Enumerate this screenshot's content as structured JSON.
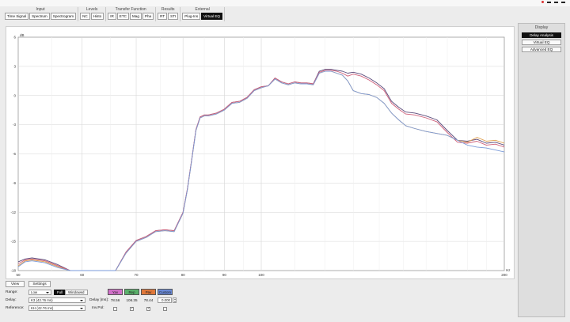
{
  "ribbon": {
    "groups": [
      {
        "title": "Input",
        "buttons": [
          "Time Signal",
          "Spectrum",
          "Spectrogram"
        ],
        "active": -1
      },
      {
        "title": "Levels",
        "buttons": [
          "NC",
          "Histo"
        ],
        "active": -1
      },
      {
        "title": "Transfer Function",
        "buttons": [
          "IR",
          "ETC",
          "Mag",
          "Pha"
        ],
        "active": -1
      },
      {
        "title": "Results",
        "buttons": [
          "RT",
          "STI"
        ],
        "active": -1
      },
      {
        "title": "External",
        "buttons": [
          "Plug-Ins",
          "Virtual EQ"
        ],
        "active": 1
      }
    ]
  },
  "display_panel": {
    "title": "Display",
    "buttons": [
      "Delay Analysis",
      "Virtual EQ",
      "Advanced EQ"
    ],
    "active": 0
  },
  "chart_data": {
    "type": "line",
    "xscale": "log",
    "xlim": [
      50,
      200
    ],
    "ylim": [
      -18,
      6
    ],
    "x_tick_labels": [
      "50",
      "60",
      "70",
      "80",
      "90",
      "100",
      "200"
    ],
    "x_unit": "Hz",
    "y_tick_labels": [
      "6",
      "3",
      "0",
      "-3",
      "-6",
      "-9",
      "-12",
      "-15",
      "-18"
    ],
    "y_unit": "dB",
    "grid": true,
    "x": [
      50,
      51,
      52,
      54,
      56,
      58,
      60,
      62,
      64,
      66,
      68,
      70,
      72,
      74,
      76,
      78,
      80,
      81,
      82,
      83,
      84,
      85,
      86,
      88,
      90,
      92,
      94,
      96,
      98,
      100,
      102,
      104,
      106,
      108,
      110,
      112,
      114,
      116,
      118,
      120,
      122,
      124,
      126,
      128,
      130,
      133,
      136,
      139,
      142,
      145,
      148,
      151,
      155,
      160,
      165,
      170,
      175,
      180,
      185,
      190,
      195,
      200
    ],
    "series": [
      {
        "color": "#5a4a7a",
        "values": [
          -17.1,
          -16.8,
          -16.7,
          -16.9,
          -17.4,
          -18.2,
          -18.8,
          -18.9,
          -18.9,
          -18.3,
          -16.1,
          -14.9,
          -14.5,
          -13.9,
          -13.8,
          -13.9,
          -12.0,
          -9.6,
          -6.6,
          -3.5,
          -2.2,
          -2.0,
          -2.0,
          -1.8,
          -1.4,
          -0.7,
          -0.6,
          -0.2,
          0.6,
          0.9,
          1.0,
          1.8,
          1.4,
          1.2,
          1.4,
          1.3,
          1.3,
          1.2,
          2.5,
          2.7,
          2.7,
          2.6,
          2.5,
          2.3,
          2.4,
          2.2,
          1.8,
          1.3,
          0.7,
          -0.6,
          -1.2,
          -1.7,
          -1.8,
          -2.1,
          -2.5,
          -3.6,
          -4.6,
          -4.7,
          -4.5,
          -4.9,
          -4.8,
          -5.1
        ]
      },
      {
        "color": "#e0a050",
        "values": [
          -17.5,
          -17.0,
          -16.9,
          -17.1,
          -17.6,
          -18.3,
          -18.8,
          -18.9,
          -18.9,
          -18.4,
          -16.2,
          -15.0,
          -14.6,
          -14.0,
          -13.9,
          -14.0,
          -12.1,
          -9.7,
          -6.7,
          -3.6,
          -2.3,
          -2.1,
          -2.1,
          -1.9,
          -1.5,
          -0.8,
          -0.7,
          -0.3,
          0.5,
          0.8,
          1.0,
          1.7,
          1.3,
          1.1,
          1.3,
          1.2,
          1.2,
          1.1,
          2.3,
          2.5,
          2.5,
          2.3,
          2.1,
          1.5,
          0.5,
          0.2,
          0.1,
          -0.2,
          -0.8,
          -1.8,
          -2.5,
          -3.1,
          -3.4,
          -3.7,
          -3.9,
          -4.1,
          -4.6,
          -4.8,
          -4.3,
          -4.7,
          -4.6,
          -4.9
        ]
      },
      {
        "color": "#d0607a",
        "values": [
          -17.3,
          -16.9,
          -16.8,
          -17.0,
          -17.5,
          -18.2,
          -18.8,
          -18.9,
          -18.9,
          -18.4,
          -16.1,
          -14.9,
          -14.5,
          -13.9,
          -13.8,
          -13.9,
          -12.0,
          -9.6,
          -6.6,
          -3.5,
          -2.2,
          -2.0,
          -2.0,
          -1.8,
          -1.4,
          -0.7,
          -0.6,
          -0.2,
          0.6,
          0.9,
          1.0,
          1.8,
          1.4,
          1.2,
          1.4,
          1.3,
          1.3,
          1.2,
          2.4,
          2.6,
          2.6,
          2.5,
          2.3,
          2.0,
          2.2,
          2.0,
          1.6,
          1.1,
          0.5,
          -0.8,
          -1.4,
          -1.9,
          -2.0,
          -2.3,
          -2.7,
          -3.8,
          -4.8,
          -4.9,
          -4.7,
          -5.1,
          -5.0,
          -5.3
        ]
      },
      {
        "color": "#7a9ad8",
        "values": [
          -17.6,
          -17.1,
          -17.0,
          -17.2,
          -17.7,
          -18.3,
          -18.8,
          -18.9,
          -18.9,
          -18.4,
          -16.2,
          -15.0,
          -14.6,
          -14.0,
          -13.9,
          -14.0,
          -12.1,
          -9.7,
          -6.7,
          -3.6,
          -2.3,
          -2.1,
          -2.1,
          -1.9,
          -1.5,
          -0.8,
          -0.7,
          -0.3,
          0.5,
          0.8,
          1.0,
          1.7,
          1.3,
          1.1,
          1.3,
          1.2,
          1.2,
          1.1,
          2.3,
          2.5,
          2.5,
          2.3,
          2.1,
          1.5,
          0.5,
          0.2,
          0.1,
          -0.2,
          -0.8,
          -1.8,
          -2.5,
          -3.1,
          -3.4,
          -3.7,
          -3.9,
          -4.1,
          -4.6,
          -5.1,
          -5.3,
          -5.4,
          -5.6,
          -5.8
        ]
      }
    ]
  },
  "bottom": {
    "view_label": "View",
    "settings_label": "Settings",
    "range_label": "Range:",
    "range_value": "Low",
    "full_label": "Full",
    "windowed_label": "Windowed",
    "delay_label": "Delay:",
    "delay_value": "K3 (42.76 ms)",
    "reference_label": "Reference:",
    "reference_value": "KH (42.76 ms)",
    "delay_ms_label": "Delay [ms]:",
    "invpol_label": "Inv.Pol:",
    "channels": [
      {
        "label": "Yav",
        "color": "#d070c8",
        "delay": "78.56",
        "invpol": false
      },
      {
        "label": "Rep",
        "color": "#5ab06a",
        "delay": "106.35",
        "invpol": true
      },
      {
        "label": "Pav",
        "color": "#e0783a",
        "delay": "78.44",
        "invpol": true
      },
      {
        "label": "Custom",
        "color": "#6a8ad8",
        "delay": "0.000",
        "invpol": false
      }
    ]
  }
}
